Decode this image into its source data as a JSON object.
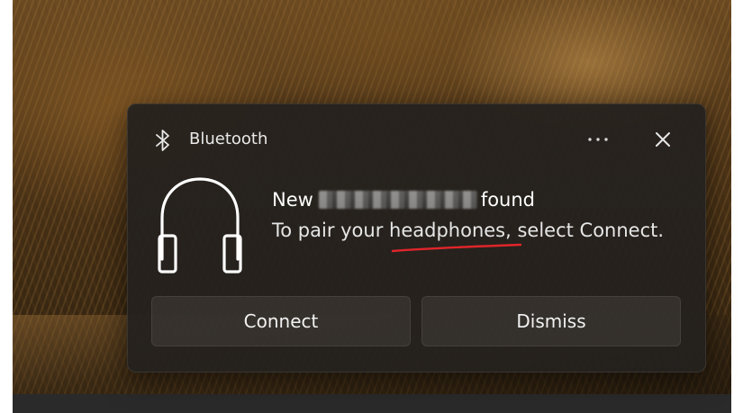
{
  "notification": {
    "app_name": "Bluetooth",
    "title_prefix": "New",
    "title_suffix": "found",
    "message_part1": "To pair your ",
    "message_highlight": "headphones",
    "message_part2": ", select Connect.",
    "more_label": "···",
    "close_label": "✕",
    "app_icon": "bluetooth-icon",
    "hero_icon": "headphones-icon"
  },
  "actions": {
    "connect_label": "Connect",
    "dismiss_label": "Dismiss"
  },
  "colors": {
    "annotation_underline": "#e0252a",
    "toast_background": "#24211e",
    "text": "#ffffff"
  }
}
